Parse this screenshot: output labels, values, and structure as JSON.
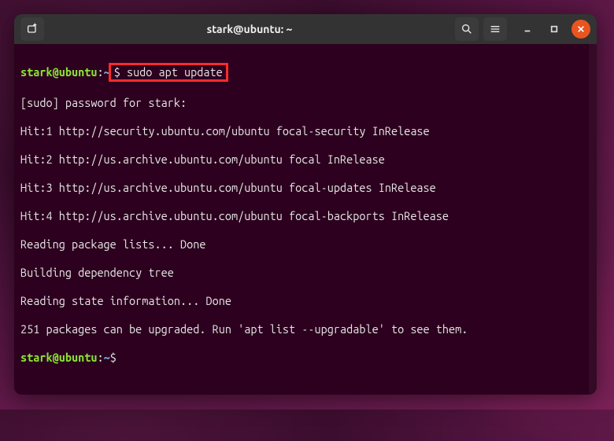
{
  "window": {
    "title": "stark@ubuntu: ~"
  },
  "prompt": {
    "user_host": "stark@ubuntu",
    "path": "~",
    "dollar": "$",
    "separator": ":"
  },
  "command": {
    "highlighted": "$ sudo apt update"
  },
  "output": {
    "lines": [
      "[sudo] password for stark:",
      "Hit:1 http://security.ubuntu.com/ubuntu focal-security InRelease",
      "Hit:2 http://us.archive.ubuntu.com/ubuntu focal InRelease",
      "Hit:3 http://us.archive.ubuntu.com/ubuntu focal-updates InRelease",
      "Hit:4 http://us.archive.ubuntu.com/ubuntu focal-backports InRelease",
      "Reading package lists... Done",
      "Building dependency tree",
      "Reading state information... Done",
      "251 packages can be upgraded. Run 'apt list --upgradable' to see them."
    ]
  },
  "icons": {
    "new_tab": "new-tab-icon",
    "search": "search-icon",
    "menu": "hamburger-icon",
    "minimize": "minimize-icon",
    "maximize": "maximize-icon",
    "close": "close-icon"
  }
}
